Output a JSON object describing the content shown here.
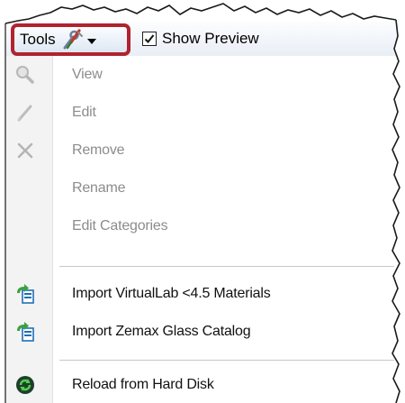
{
  "toolbar": {
    "tools_label": "Tools",
    "tools_icon": "tools-icon",
    "show_preview_label": "Show Preview",
    "show_preview_checked": true,
    "highlight_color": "#b0232f"
  },
  "menu": {
    "items": [
      {
        "label": "View",
        "icon": "magnifier-icon",
        "enabled": false
      },
      {
        "label": "Edit",
        "icon": "pencil-icon",
        "enabled": false
      },
      {
        "label": "Remove",
        "icon": "x-icon",
        "enabled": false
      },
      {
        "label": "Rename",
        "icon": "",
        "enabled": false
      },
      {
        "label": "Edit Categories",
        "icon": "",
        "enabled": false
      },
      {
        "label": "Import VirtualLab <4.5 Materials",
        "icon": "import-icon",
        "enabled": true
      },
      {
        "label": "Import Zemax Glass Catalog",
        "icon": "import-icon",
        "enabled": true
      },
      {
        "label": "Reload from Hard Disk",
        "icon": "reload-icon",
        "enabled": true
      }
    ]
  }
}
